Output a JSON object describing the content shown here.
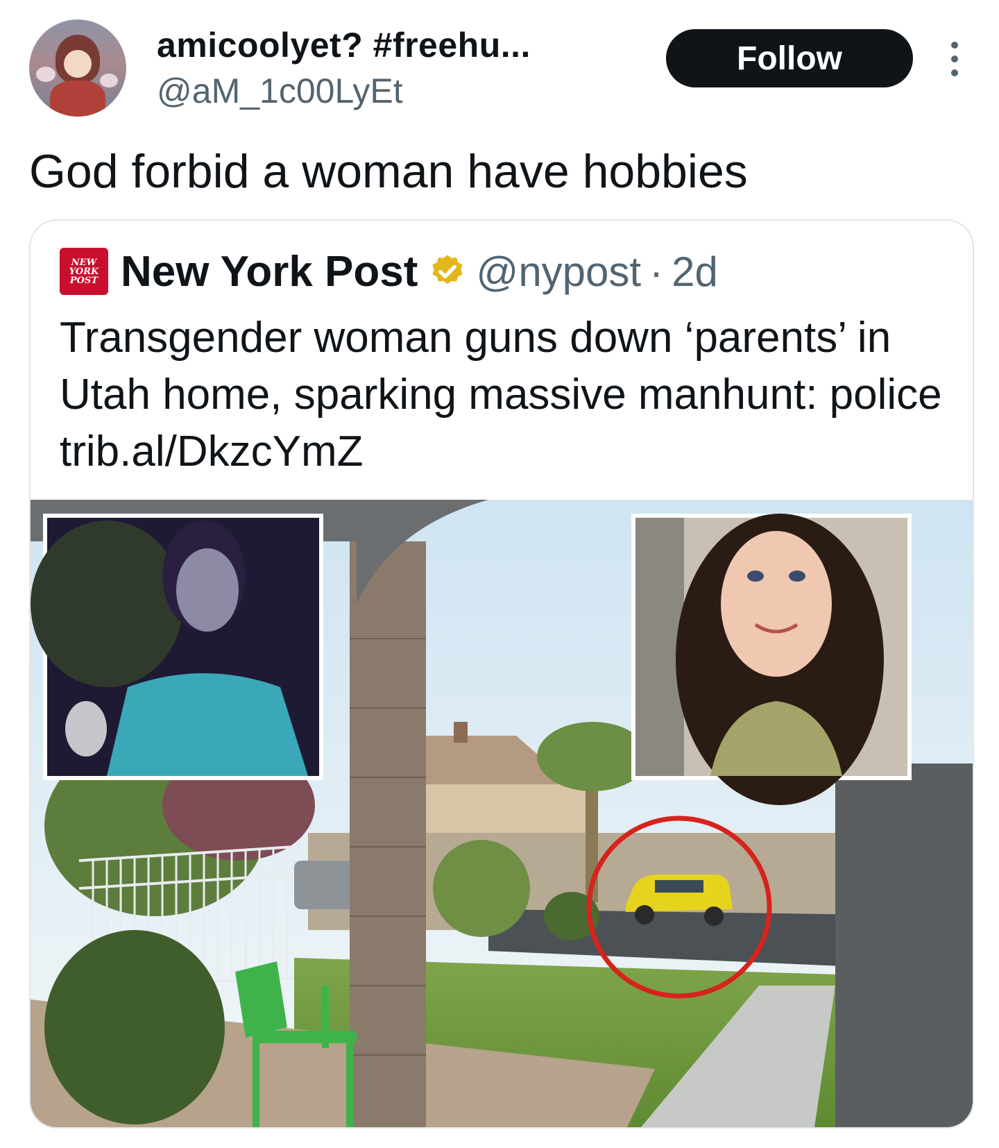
{
  "author": {
    "display_name": "amicoolyet? #freehu...",
    "handle": "@aM_1c00LyEt",
    "avatar_icon": "anime-avatar-icon"
  },
  "follow_label": "Follow",
  "tweet_text": "God forbid a woman have hobbies",
  "quoted": {
    "logo_lines": [
      "NEW",
      "YORK",
      "POST"
    ],
    "name": "New York Post",
    "verified": true,
    "handle": "@nypost",
    "separator": "·",
    "time": "2d",
    "text": "Transgender woman guns down ‘parents’ in Utah home, sparking massive manhunt: police trib.al/DkzcYmZ",
    "media_description_icon": "news-photo-collage"
  },
  "colors": {
    "text": "#0f1419",
    "secondary": "#536471",
    "follow_bg": "#0f1419",
    "nyp_red": "#c8102e",
    "verified_gold": "#e2b719",
    "circle_red": "#d6231c",
    "car_yellow": "#e6d31e"
  }
}
